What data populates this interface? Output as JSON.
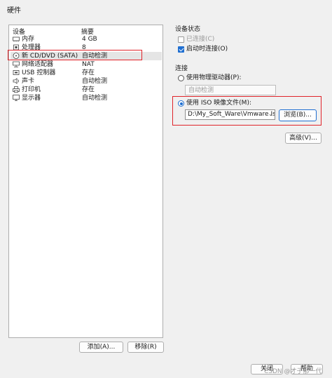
{
  "window": {
    "title": "硬件"
  },
  "device_list": {
    "headers": {
      "device": "设备",
      "summary": "摘要"
    },
    "items": [
      {
        "name": "内存",
        "summary": "4 GB",
        "icon": "memory-icon"
      },
      {
        "name": "处理器",
        "summary": "8",
        "icon": "processor-icon"
      },
      {
        "name": "新 CD/DVD (SATA)",
        "summary": "自动检测",
        "icon": "cd-dvd-icon"
      },
      {
        "name": "网络适配器",
        "summary": "NAT",
        "icon": "network-adapter-icon"
      },
      {
        "name": "USB 控制器",
        "summary": "存在",
        "icon": "usb-controller-icon"
      },
      {
        "name": "声卡",
        "summary": "自动检测",
        "icon": "sound-card-icon"
      },
      {
        "name": "打印机",
        "summary": "存在",
        "icon": "printer-icon"
      },
      {
        "name": "显示器",
        "summary": "自动检测",
        "icon": "display-icon"
      }
    ],
    "selected_index": 2
  },
  "buttons": {
    "add": "添加(A)...",
    "remove": "移除(R)",
    "browse": "浏览(B)...",
    "advanced": "高级(V)...",
    "close": "关闭",
    "help": "帮助"
  },
  "device_status": {
    "group_label": "设备状态",
    "connected": {
      "label": "已连接(C)",
      "checked": false,
      "enabled": false
    },
    "connect_at_power_on": {
      "label": "启动时连接(O)",
      "checked": true,
      "enabled": true
    }
  },
  "connection": {
    "group_label": "连接",
    "physical_drive": {
      "label": "使用物理驱动器(P):",
      "selected": false
    },
    "physical_drive_value": "自动检测",
    "iso_image": {
      "label": "使用 ISO 映像文件(M):",
      "selected": true
    },
    "iso_path": "D:\\My_Soft_Ware\\Vmware Iso"
  },
  "watermark": "CSDN @才子那一代",
  "colors": {
    "highlight_red": "#e0242a",
    "accent_blue": "#1f6fd1",
    "selected_row_bg": "#e5e5e5"
  }
}
